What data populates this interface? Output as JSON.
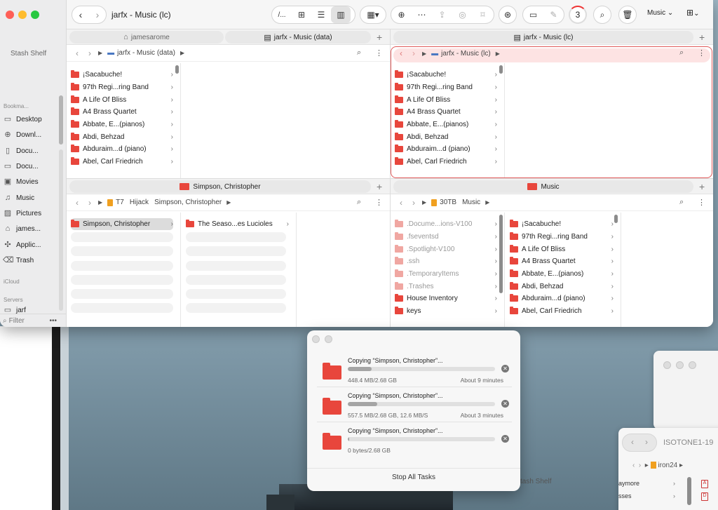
{
  "window": {
    "title": "jarfx - Music (lc)"
  },
  "toolbar": {
    "path_button": "/...",
    "music_label": "Music",
    "progress_count": "3"
  },
  "sidebar": {
    "shelf_label": "Stash Shelf",
    "bookmarks_header": "Bookma...",
    "items": [
      {
        "label": "Desktop",
        "icon": "desktop-icon"
      },
      {
        "label": "Downl...",
        "icon": "download-icon"
      },
      {
        "label": "Docu...",
        "icon": "document-icon"
      },
      {
        "label": "Docu...",
        "icon": "folder-icon"
      },
      {
        "label": "Movies",
        "icon": "movie-icon"
      },
      {
        "label": "Music",
        "icon": "music-icon"
      },
      {
        "label": "Pictures",
        "icon": "pictures-icon"
      },
      {
        "label": "james...",
        "icon": "home-icon"
      },
      {
        "label": "Applic...",
        "icon": "apps-icon"
      },
      {
        "label": "Trash",
        "icon": "trash-icon"
      }
    ],
    "icloud_header": "iCloud",
    "servers_header": "Servers",
    "server_item": "jarf",
    "filter_label": "Filter"
  },
  "pane_tl": {
    "tabs": [
      {
        "label": "jamesarome"
      },
      {
        "label": "jarfx - Music (data)"
      }
    ],
    "path": [
      "jarfx - Music (data)"
    ],
    "items": [
      "¡Sacabuche!",
      "97th Regi...ring Band",
      "A Life Of Bliss",
      "A4 Brass Quartet",
      "Abbate, E...(pianos)",
      "Abdi, Behzad",
      "Abduraim...d (piano)",
      "Abel, Carl Friedrich"
    ]
  },
  "pane_tr": {
    "tabs": [
      {
        "label": "jarfx - Music (lc)"
      }
    ],
    "path": [
      "jarfx - Music (lc)"
    ],
    "items": [
      "¡Sacabuche!",
      "97th Regi...ring Band",
      "A Life Of Bliss",
      "A4 Brass Quartet",
      "Abbate, E...(pianos)",
      "Abdi, Behzad",
      "Abduraim...d (piano)",
      "Abel, Carl Friedrich"
    ]
  },
  "pane_bl": {
    "tabs": [
      {
        "label": "Simpson, Christopher"
      }
    ],
    "path": [
      "T7",
      "Hijack",
      "Simpson, Christopher"
    ],
    "col1": [
      "Simpson, Christopher"
    ],
    "col2": [
      "The Seaso...es Lucioles"
    ]
  },
  "pane_br": {
    "tabs": [
      {
        "label": "Music"
      }
    ],
    "path": [
      "30TB",
      "Music"
    ],
    "col1": [
      {
        "label": ".Docume...ions-V100",
        "faded": true
      },
      {
        "label": ".fseventsd",
        "faded": true
      },
      {
        "label": ".Spotlight-V100",
        "faded": true
      },
      {
        "label": ".ssh",
        "faded": true
      },
      {
        "label": ".TemporaryItems",
        "faded": true
      },
      {
        "label": ".Trashes",
        "faded": true
      },
      {
        "label": "House Inventory",
        "faded": false
      },
      {
        "label": "keys",
        "faded": false
      }
    ],
    "col2": [
      "¡Sacabuche!",
      "97th Regi...ring Band",
      "A Life Of Bliss",
      "A4 Brass Quartet",
      "Abbate, E...(pianos)",
      "Abdi, Behzad",
      "Abduraim...d (piano)",
      "Abel, Carl Friedrich"
    ]
  },
  "copy_dialog": {
    "jobs": [
      {
        "title": "Copying “Simpson, Christopher”...",
        "status": "448.4 MB/2.68 GB",
        "eta": "About 9 minutes",
        "progress": 0.16
      },
      {
        "title": "Copying “Simpson, Christopher”...",
        "status": "557.5 MB/2.68 GB, 12.6 MB/S",
        "eta": "About 3 minutes",
        "progress": 0.2
      },
      {
        "title": "Copying “Simpson, Christopher”...",
        "status": "0 bytes/2.68 GB",
        "eta": "",
        "progress": 0.01
      }
    ],
    "stop_label": "Stop All Tasks"
  },
  "background": {
    "window_title": "ISOTONE1-19",
    "window_path": "iron24",
    "rows": [
      "aymore",
      "sses"
    ],
    "stash_label": "tash Shelf"
  },
  "colors": {
    "folder_red": "#e8463c",
    "highlight_outline": "#e05a5a"
  }
}
